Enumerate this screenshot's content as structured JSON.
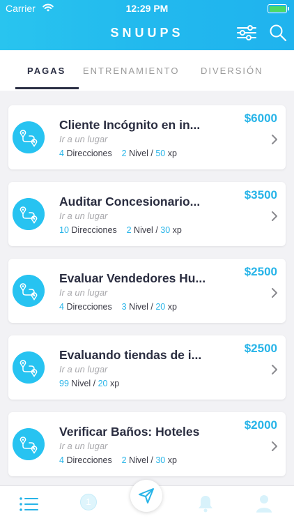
{
  "status_bar": {
    "carrier": "Carrier",
    "time": "12:29 PM"
  },
  "header": {
    "title": "SNUUPS"
  },
  "tabs": [
    {
      "label": "PAGAS",
      "active": true
    },
    {
      "label": "ENTRENAMIENTO",
      "active": false
    },
    {
      "label": "DIVERSIÓN",
      "active": false
    }
  ],
  "cards": [
    {
      "title": "Cliente Incógnito en in...",
      "subtitle": "Ir a un lugar",
      "price": "$6000",
      "directions": "4",
      "directions_label": "Direcciones",
      "level": "2",
      "level_label": "Nivel",
      "xp": "50",
      "xp_label": "xp"
    },
    {
      "title": "Auditar Concesionario...",
      "subtitle": "Ir a un lugar",
      "price": "$3500",
      "directions": "10",
      "directions_label": "Direcciones",
      "level": "2",
      "level_label": "Nivel",
      "xp": "30",
      "xp_label": "xp"
    },
    {
      "title": "Evaluar Vendedores Hu...",
      "subtitle": "Ir a un lugar",
      "price": "$2500",
      "directions": "4",
      "directions_label": "Direcciones",
      "level": "3",
      "level_label": "Nivel",
      "xp": "20",
      "xp_label": "xp"
    },
    {
      "title": "Evaluando tiendas de i...",
      "subtitle": "Ir a un lugar",
      "price": "$2500",
      "level": "99",
      "level_label": "Nivel",
      "xp": "20",
      "xp_label": "xp"
    },
    {
      "title": "Verificar Baños: Hoteles",
      "subtitle": "Ir a un lugar",
      "price": "$2000",
      "directions": "4",
      "directions_label": "Direcciones",
      "level": "2",
      "level_label": "Nivel",
      "xp": "30",
      "xp_label": "xp"
    }
  ],
  "tab_bar": {
    "badge_count": "1",
    "icons": [
      "list-icon",
      "badge-icon",
      "navigate-icon",
      "bell-icon",
      "profile-icon"
    ]
  },
  "colors": {
    "accent": "#27b4e8",
    "header_gradient": [
      "#29c4ef",
      "#1fb3ee"
    ],
    "title_text": "#2a2d40"
  }
}
